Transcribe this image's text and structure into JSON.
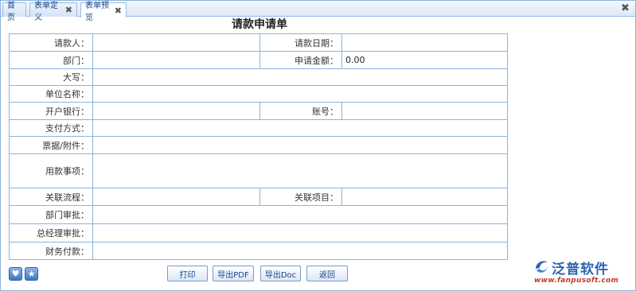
{
  "tabs": [
    {
      "label": "首页",
      "closable": false
    },
    {
      "label": "表单定义",
      "closable": true
    },
    {
      "label": "表单预览",
      "closable": true,
      "active": true
    }
  ],
  "close_glyph": "✖",
  "form": {
    "title": "请款申请单",
    "fields": {
      "requester": {
        "label": "请款人：",
        "value": ""
      },
      "request_date": {
        "label": "请款日期：",
        "value": ""
      },
      "department": {
        "label": "部门：",
        "value": ""
      },
      "amount": {
        "label": "申请金额：",
        "value": "0.00"
      },
      "amount_in_words": {
        "label": "大写：",
        "value": ""
      },
      "company_name": {
        "label": "单位名称：",
        "value": ""
      },
      "bank": {
        "label": "开户银行：",
        "value": ""
      },
      "account": {
        "label": "账号：",
        "value": ""
      },
      "payment_method": {
        "label": "支付方式：",
        "value": ""
      },
      "attachments": {
        "label": "票据/附件：",
        "value": ""
      },
      "purpose": {
        "label": "用款事项：",
        "value": ""
      },
      "related_flow": {
        "label": "关联流程：",
        "value": ""
      },
      "related_project": {
        "label": "关联项目：",
        "value": ""
      },
      "dept_approval": {
        "label": "部门审批：",
        "value": ""
      },
      "gm_approval": {
        "label": "总经理审批：",
        "value": ""
      },
      "finance_payment": {
        "label": "财务付款：",
        "value": ""
      }
    }
  },
  "buttons": {
    "print": "打印",
    "export_pdf": "导出PDF",
    "export_doc": "导出Doc",
    "back": "返回"
  },
  "icons": {
    "favorite": "heart-icon",
    "star": "star-icon"
  },
  "logo": {
    "name": "泛普软件",
    "url": "www.fanpusoft.com"
  }
}
